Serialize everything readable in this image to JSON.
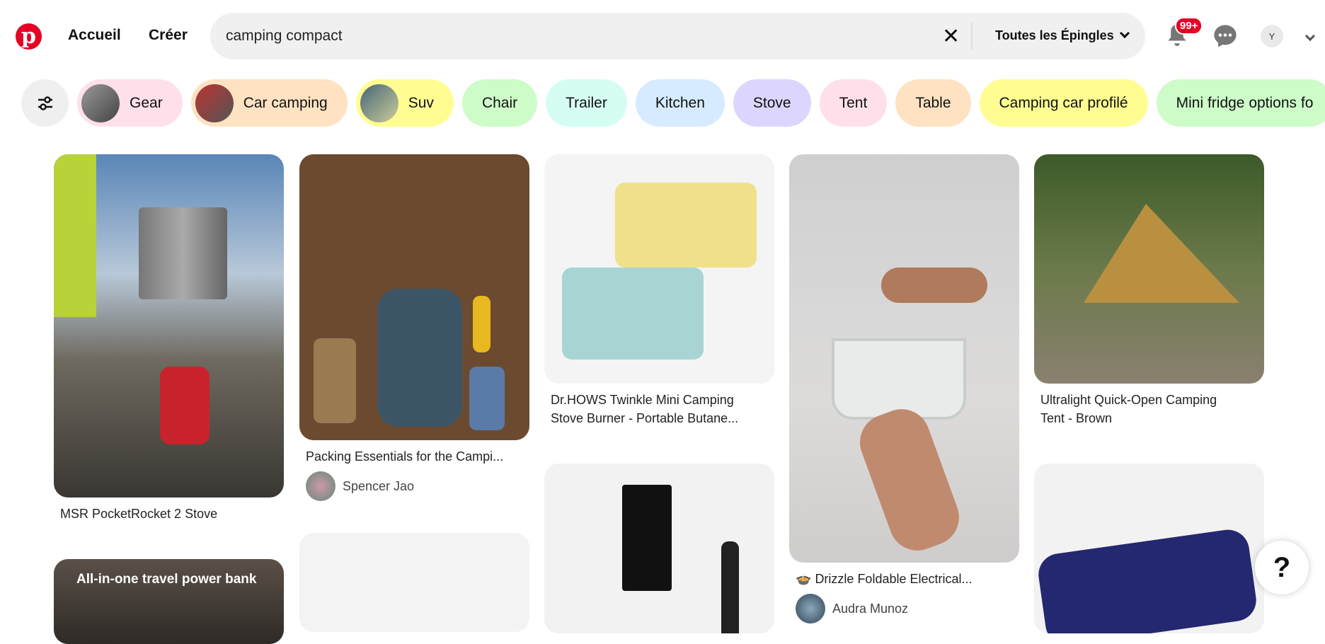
{
  "header": {
    "nav": [
      "Accueil",
      "Créer"
    ],
    "search_value": "camping compact",
    "filter_label": "Toutes les Épingles",
    "notification_count": "99+",
    "avatar_initial": "Y",
    "brand_color": "#e60023"
  },
  "chips": [
    {
      "label": "Gear",
      "color": "#ffe0ea",
      "thumb": true
    },
    {
      "label": "Car camping",
      "color": "#ffe2c2",
      "thumb": true
    },
    {
      "label": "Suv",
      "color": "#fffd92",
      "thumb": true
    },
    {
      "label": "Chair",
      "color": "#cdfcc8"
    },
    {
      "label": "Trailer",
      "color": "#d6fdf4"
    },
    {
      "label": "Kitchen",
      "color": "#d6ebff"
    },
    {
      "label": "Stove",
      "color": "#dcd6ff"
    },
    {
      "label": "Tent",
      "color": "#ffe0ea"
    },
    {
      "label": "Table",
      "color": "#ffe2c2"
    },
    {
      "label": "Camping car profilé",
      "color": "#fffd92"
    },
    {
      "label": "Mini fridge options fo",
      "color": "#cdfcc8"
    }
  ],
  "pins": [
    {
      "title": "MSR PocketRocket 2 Stove"
    },
    {
      "title": "Packing Essentials for the Campi...",
      "user": "Spencer Jao"
    },
    {
      "title_lines": [
        "Dr.HOWS Twinkle Mini Camping",
        "Stove Burner - Portable Butane..."
      ]
    },
    {
      "title": "Drizzle Foldable Electrical...",
      "user": "Audra Munoz"
    },
    {
      "title_lines": [
        "Ultralight Quick-Open Camping",
        "Tent - Brown"
      ]
    },
    {
      "overlay_text": "All-in-one travel power bank"
    }
  ],
  "help": {
    "label": "?"
  }
}
